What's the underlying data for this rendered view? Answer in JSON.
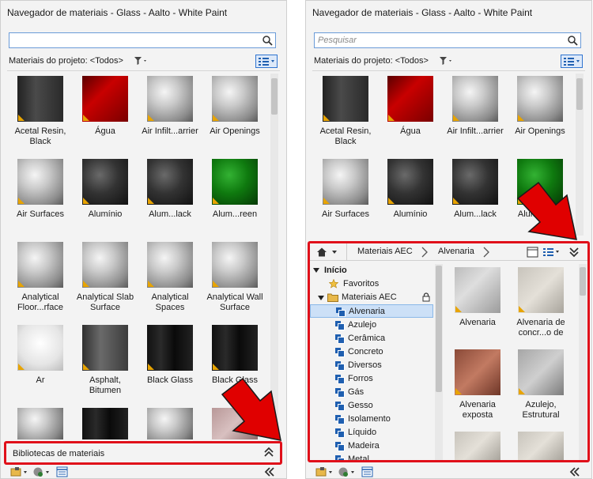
{
  "left": {
    "title": "Navegador de materiais - Glass - Aalto - White Paint",
    "search_placeholder": "",
    "filter_label": "Materiais do projeto: <Todos>",
    "materials": [
      {
        "name": "Acetal Resin, Black"
      },
      {
        "name": "Água"
      },
      {
        "name": "Air Infilt...arrier"
      },
      {
        "name": "Air Openings"
      },
      {
        "name": "Air Surfaces"
      },
      {
        "name": "Alumínio"
      },
      {
        "name": "Alum...lack"
      },
      {
        "name": "Alum...reen"
      },
      {
        "name": "Analytical Floor...rface"
      },
      {
        "name": "Analytical Slab Surface"
      },
      {
        "name": "Analytical Spaces"
      },
      {
        "name": "Analytical Wall Surface"
      },
      {
        "name": "Ar"
      },
      {
        "name": "Asphalt, Bitumen"
      },
      {
        "name": "Black Glass"
      },
      {
        "name": "Black Glass"
      }
    ],
    "library_bar_label": "Bibliotecas de materiais"
  },
  "right": {
    "title": "Navegador de materiais - Glass - Aalto - White Paint",
    "search_placeholder": "Pesquisar",
    "filter_label": "Materiais do projeto: <Todos>",
    "materials": [
      {
        "name": "Acetal Resin, Black"
      },
      {
        "name": "Água"
      },
      {
        "name": "Air Infilt...arrier"
      },
      {
        "name": "Air Openings"
      },
      {
        "name": "Air Surfaces"
      },
      {
        "name": "Alumínio"
      },
      {
        "name": "Alum...lack"
      },
      {
        "name": "Alum...reen"
      }
    ],
    "breadcrumb": {
      "home": "Início",
      "level1": "Materiais AEC",
      "level2": "Alvenaria"
    },
    "tree": {
      "root": "Início",
      "favorites": "Favoritos",
      "library": "Materiais AEC",
      "categories": [
        "Alvenaria",
        "Azulejo",
        "Cerâmica",
        "Concreto",
        "Diversos",
        "Forros",
        "Gás",
        "Gesso",
        "Isolamento",
        "Líquido",
        "Madeira",
        "Metal"
      ],
      "selected": "Alvenaria"
    },
    "library_items": [
      {
        "name": "Alvenaria"
      },
      {
        "name": "Alvenaria de concr...o de"
      },
      {
        "name": "Alvenaria exposta"
      },
      {
        "name": "Azulejo, Estrutural"
      }
    ]
  },
  "colors": {
    "highlight": "#e0101a",
    "accent": "#2f74d0",
    "badge": "#e8a400"
  }
}
